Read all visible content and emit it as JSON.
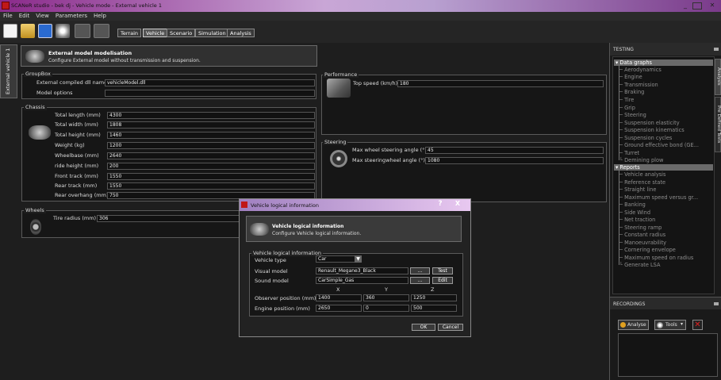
{
  "window": {
    "title": "SCANeR studio - bek dj - Vehicle mode - External vehicle 1"
  },
  "menu": [
    "File",
    "Edit",
    "View",
    "Parameters",
    "Help"
  ],
  "mode_buttons": [
    "Terrain",
    "Vehicle",
    "Scenario",
    "Simulation",
    "Analysis"
  ],
  "side_tab": "External vehicle 1",
  "module": {
    "title": "External model modelisation",
    "subtitle": "Configure External model without transmission and suspension."
  },
  "groupbox": {
    "legend": "GroupBox",
    "dll_label": "External compiled dll name",
    "dll_value": "vehicleModel.dll",
    "options_label": "Model options",
    "options_value": ""
  },
  "chassis": {
    "legend": "Chassis",
    "fields": [
      {
        "label": "Total length (mm)",
        "value": "4300"
      },
      {
        "label": "Total width (mm)",
        "value": "1808"
      },
      {
        "label": "Total height (mm)",
        "value": "1460"
      },
      {
        "label": "Weight (kg)",
        "value": "1200"
      },
      {
        "label": "Wheelbase (mm)",
        "value": "2640"
      },
      {
        "label": "ride height (mm)",
        "value": "200"
      },
      {
        "label": "Front track (mm)",
        "value": "1550"
      },
      {
        "label": "Rear track (mm)",
        "value": "1550"
      },
      {
        "label": "Rear overhang (mm)",
        "value": "750"
      }
    ]
  },
  "wheels": {
    "legend": "Wheels",
    "label": "Tire radius (mm)",
    "value": "306"
  },
  "performance": {
    "legend": "Performance",
    "label": "Top speed (km/h)",
    "value": "180"
  },
  "steering": {
    "legend": "Steering",
    "wheel_label": "Max wheel steering angle (°)",
    "wheel_value": "45",
    "sw_label": "Max steeringwheel angle (°)",
    "sw_value": "1080"
  },
  "testing": {
    "title": "TESTING",
    "side_tabs": [
      "Analysis",
      "Pre Defined Tests"
    ],
    "data_graphs": {
      "label": "Data graphs",
      "items": [
        "Aerodynamics",
        "Engine",
        "Transmission",
        "Braking",
        "Tire",
        "Grip",
        "Steering",
        "Suspension elasticity",
        "Suspension kinematics",
        "Suspension cycles",
        "Ground effective bond (GE...",
        "Turret",
        "Demining plow"
      ]
    },
    "reports": {
      "label": "Reports",
      "items": [
        "Vehicle analysis",
        "Reference state",
        "Straight line",
        "Maximum speed versus gr...",
        "Banking",
        "Side Wind",
        "Net traction",
        "Steering ramp",
        "Constant radius",
        "Manoeuvrability",
        "Cornering envelope",
        "Maximum speed on radius",
        "Generate LSA"
      ]
    }
  },
  "recordings": {
    "title": "RECORDINGS",
    "analyse": "Analyse",
    "tools": "Tools"
  },
  "dialog": {
    "title": "Vehicle logical information",
    "help": "?",
    "close": "X",
    "header_title": "Vehicle logical information",
    "header_subtitle": "Configure Vehicle logical information.",
    "legend": "Vehicle logical information",
    "type_label": "Vehicle type",
    "type_value": "Car",
    "visual_label": "Visual model",
    "visual_value": "Renault_Megane3_Black",
    "sound_label": "Sound model",
    "sound_value": "CarSimple_Gas",
    "browse": "...",
    "test": "Test",
    "edit": "Edit",
    "col_x": "X",
    "col_y": "Y",
    "col_z": "Z",
    "observer_label": "Observer position (mm)",
    "observer": [
      "1400",
      "360",
      "1250"
    ],
    "engine_label": "Engine position (mm)",
    "engine": [
      "2650",
      "0",
      "500"
    ],
    "ok": "OK",
    "cancel": "Cancel"
  }
}
